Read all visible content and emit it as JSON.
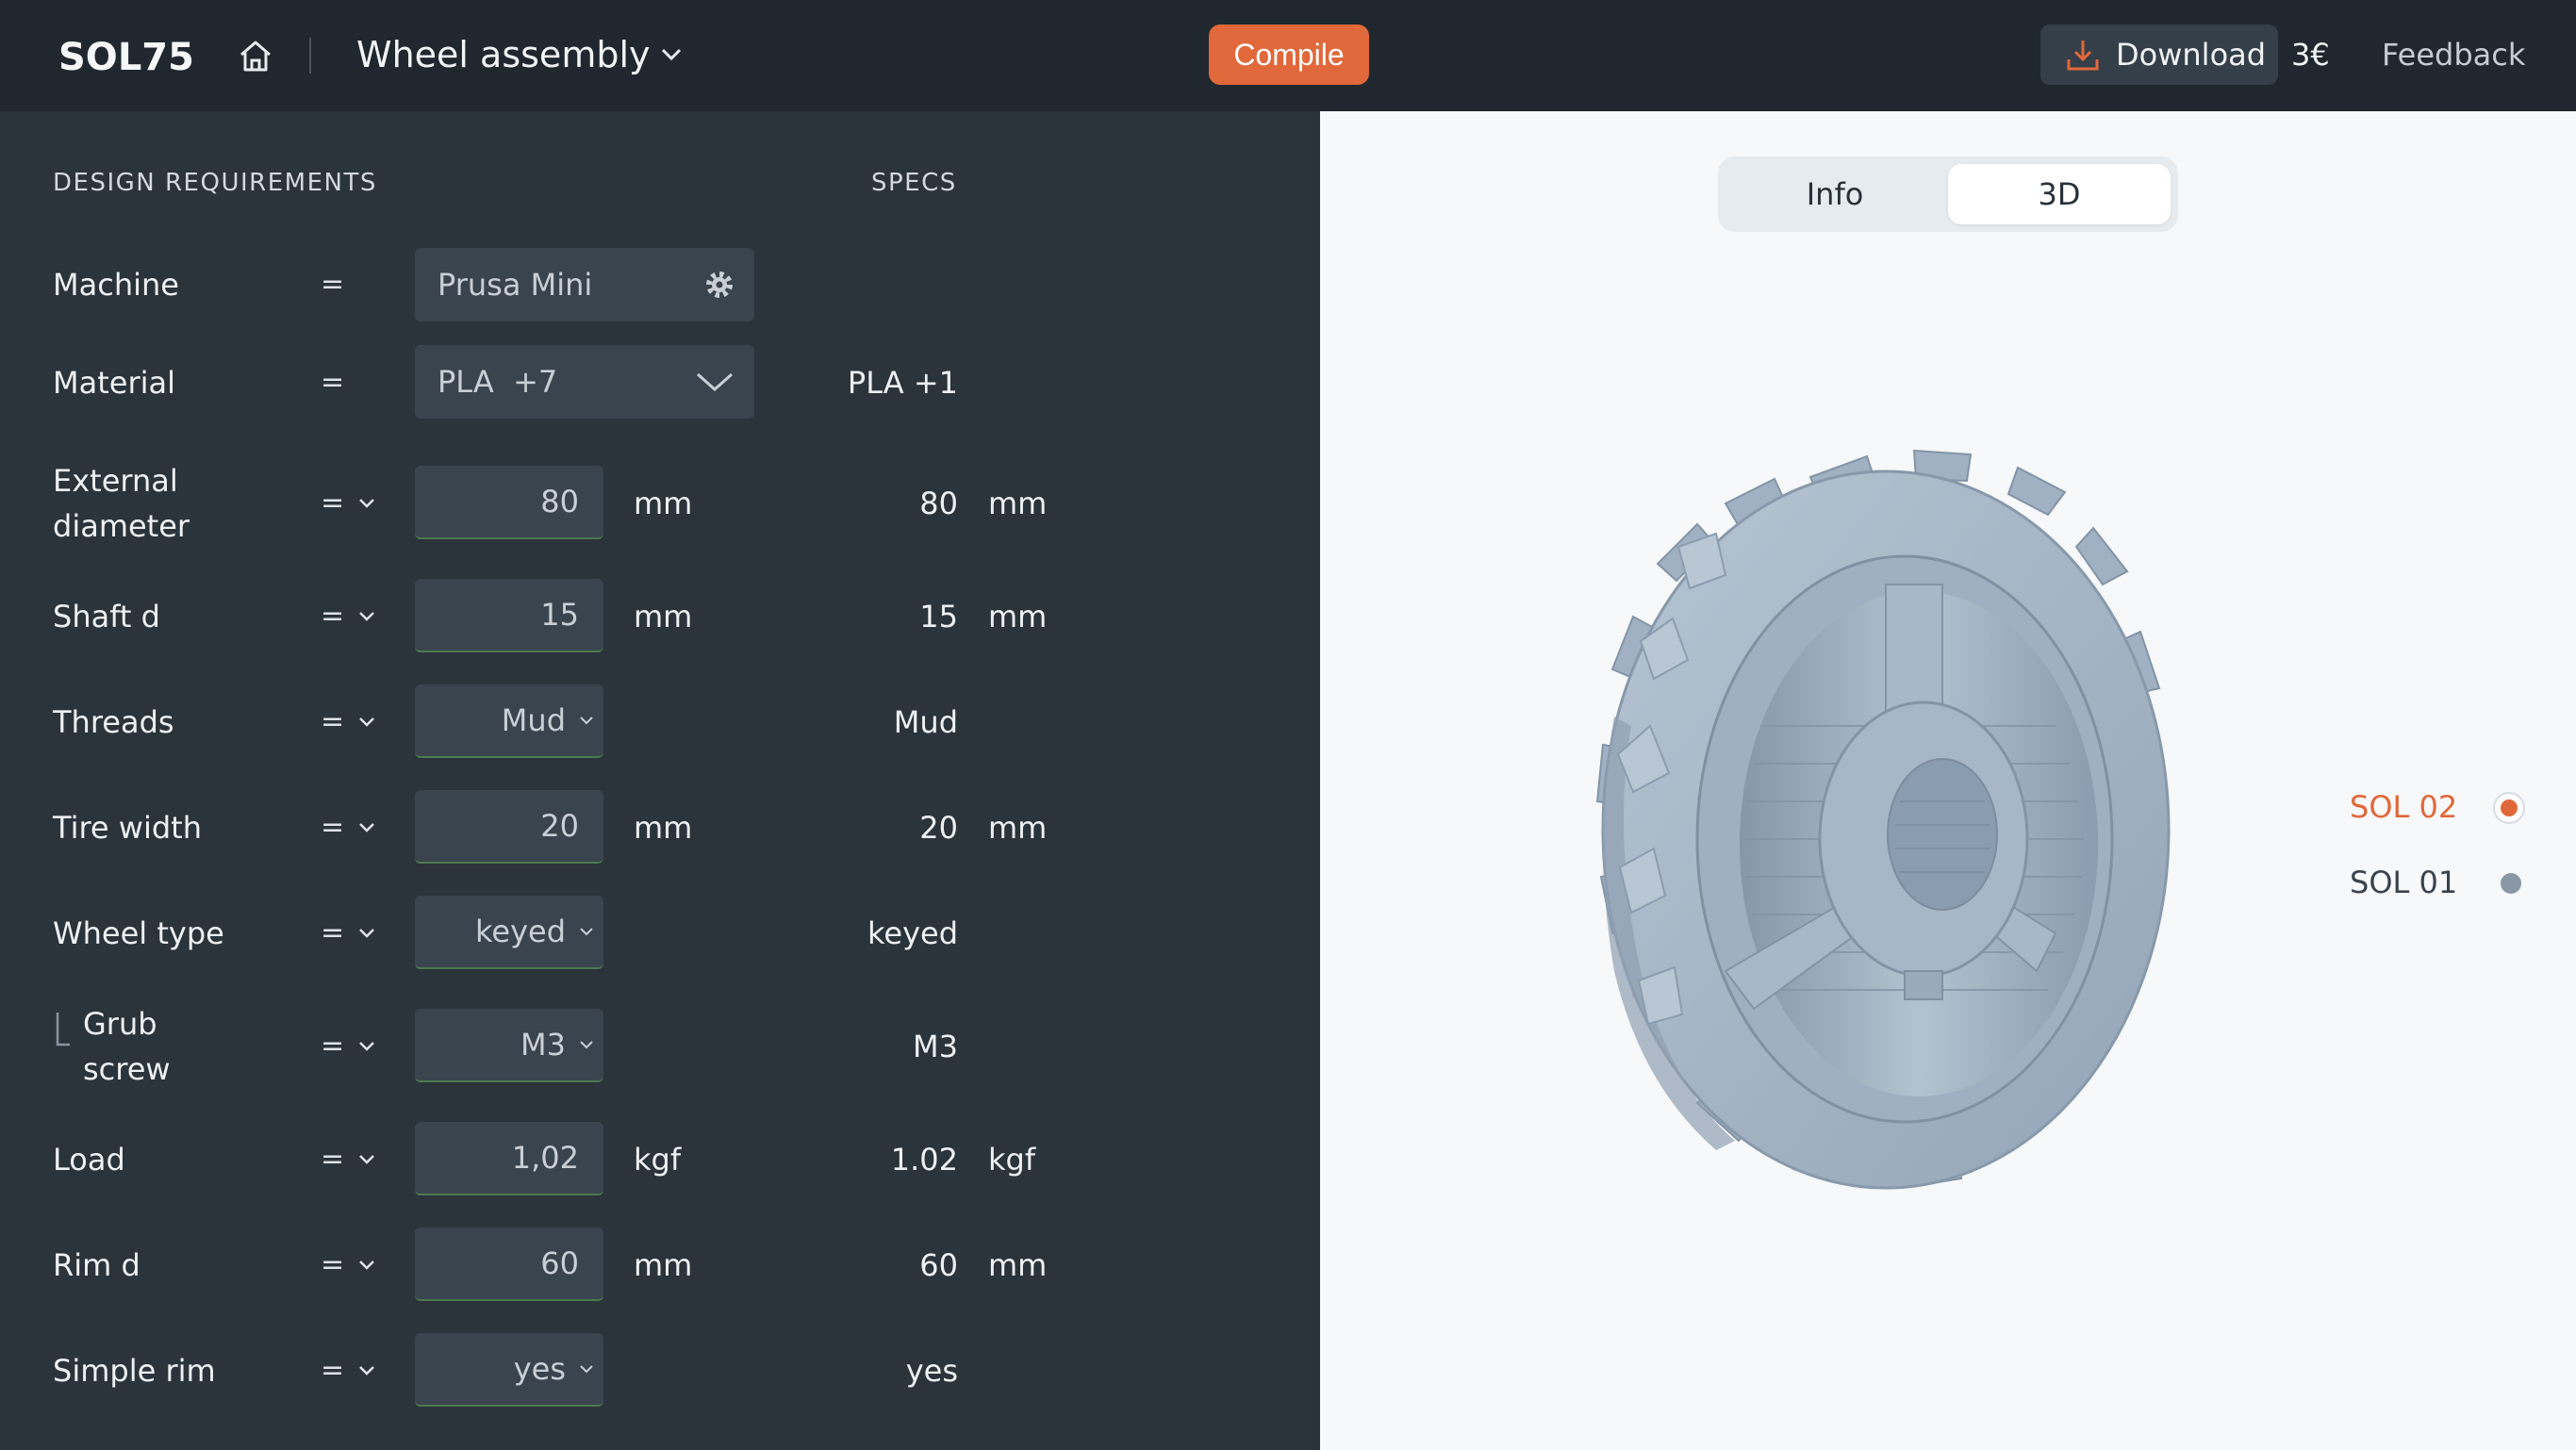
{
  "header": {
    "logo_text": "SOL75",
    "project_title": "Wheel assembly",
    "compile_label": "Compile",
    "download_label": "Download",
    "price": "3€",
    "feedback_label": "Feedback"
  },
  "panel": {
    "design_heading": "DESIGN REQUIREMENTS",
    "specs_heading": "SPECS",
    "rows": [
      {
        "label": "Machine",
        "op": "=",
        "value": "Prusa Mini",
        "spec": ""
      },
      {
        "label": "Material",
        "op": "=",
        "value": "PLA  +7",
        "spec": "PLA +1"
      },
      {
        "label_line1": "External",
        "label_line2": "diameter",
        "op": "=",
        "value": "80",
        "unit": "mm",
        "spec": "80",
        "spec_unit": "mm"
      },
      {
        "label": "Shaft d",
        "op": "=",
        "value": "15",
        "unit": "mm",
        "spec": "15",
        "spec_unit": "mm"
      },
      {
        "label": "Threads",
        "op": "=",
        "value": "Mud",
        "spec": "Mud"
      },
      {
        "label": "Tire width",
        "op": "=",
        "value": "20",
        "unit": "mm",
        "spec": "20",
        "spec_unit": "mm"
      },
      {
        "label": "Wheel type",
        "op": "=",
        "value": "keyed",
        "spec": "keyed"
      },
      {
        "label_line1": "Grub",
        "label_line2": "screw",
        "op": "=",
        "value": "M3",
        "spec": "M3"
      },
      {
        "label": "Load",
        "op": "=",
        "value": "1,02",
        "unit": "kgf",
        "spec": "1.02",
        "spec_unit": "kgf"
      },
      {
        "label": "Rim d",
        "op": "=",
        "value": "60",
        "unit": "mm",
        "spec": "60",
        "spec_unit": "mm"
      },
      {
        "label": "Simple rim",
        "op": "=",
        "value": "yes",
        "spec": "yes"
      }
    ]
  },
  "viewer": {
    "tabs": [
      {
        "label": "Info",
        "active": false
      },
      {
        "label": "3D",
        "active": true
      }
    ],
    "solutions": [
      {
        "label": "SOL 02",
        "color": "#e0683a",
        "selected": true
      },
      {
        "label": "SOL 01",
        "color": "#8a98a6",
        "selected": false
      }
    ]
  },
  "colors": {
    "accent": "#e0683a",
    "model": "#a9b9c9"
  },
  "icons": {
    "home": "home-icon",
    "gear": "gear-icon",
    "download": "download-icon",
    "chevron": "chevron-down-icon"
  }
}
